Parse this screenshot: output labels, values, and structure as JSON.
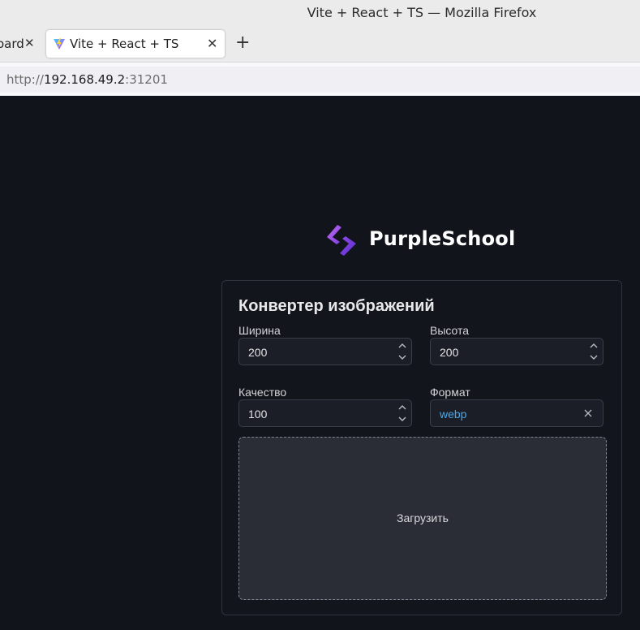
{
  "browser": {
    "window_title": "Vite + React + TS — Mozilla Firefox",
    "prev_tab_label": "oard",
    "active_tab_label": "Vite + React + TS",
    "tab_close_glyph": "✕",
    "new_tab_glyph": "+",
    "url_scheme": "http://",
    "url_host": "192.168.49.2",
    "url_port": ":31201"
  },
  "brand": {
    "name": "PurpleSchool",
    "logo_icon": "purpleschool-logo-icon",
    "accent_colors": [
      "#6f3bd9",
      "#b15cf0"
    ]
  },
  "converter": {
    "title": "Конвертер изображений",
    "width": {
      "label": "Ширина",
      "value": "200"
    },
    "height": {
      "label": "Высота",
      "value": "200"
    },
    "quality": {
      "label": "Качество",
      "value": "100"
    },
    "format": {
      "label": "Формат",
      "value": "webp",
      "value_color": "#4aa8e8"
    },
    "upload_label": "Загрузить"
  }
}
